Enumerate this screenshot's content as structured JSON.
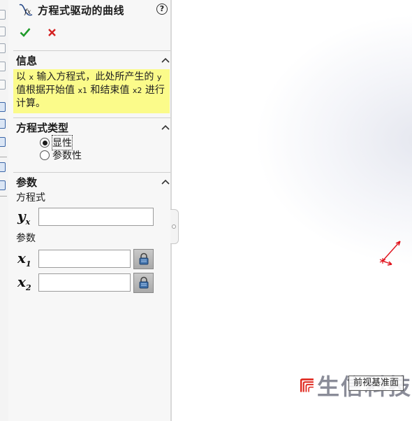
{
  "panel": {
    "title": "方程式驱动的曲线",
    "help": "?",
    "ok_glyph": "✔",
    "cancel_glyph": "✕"
  },
  "info": {
    "header": "信息",
    "parts": [
      "以 ",
      "x",
      " 输入方程式，此处所产生的 ",
      "y",
      " 值根据开始值 ",
      "x1",
      " 和结束值 ",
      "x2",
      " 进行计算。"
    ]
  },
  "equation_type": {
    "header": "方程式类型",
    "options": [
      "显性",
      "参数性"
    ],
    "selected": "显性"
  },
  "parameters": {
    "header": "参数",
    "equation_label": "方程式",
    "yx_label": "y",
    "yx_sub": "x",
    "yx_value": "",
    "params_label": "参数",
    "x1_label": "x",
    "x1_sub": "1",
    "x1_value": "",
    "x2_label": "x",
    "x2_sub": "2",
    "x2_value": ""
  },
  "graphics": {
    "tooltip": "前视基准面",
    "watermark": "生信科技"
  },
  "colors": {
    "ok_green": "#1f9a2a",
    "cancel_red": "#d42020",
    "info_bg": "#fbfb8a",
    "triad_red": "#e0101a",
    "brand_red": "#e0281e"
  },
  "icons": {
    "title": "equation-curve-icon",
    "ok": "checkmark-icon",
    "cancel": "close-icon",
    "collapse": "chevron-up-icon",
    "lock": "lock-icon"
  }
}
